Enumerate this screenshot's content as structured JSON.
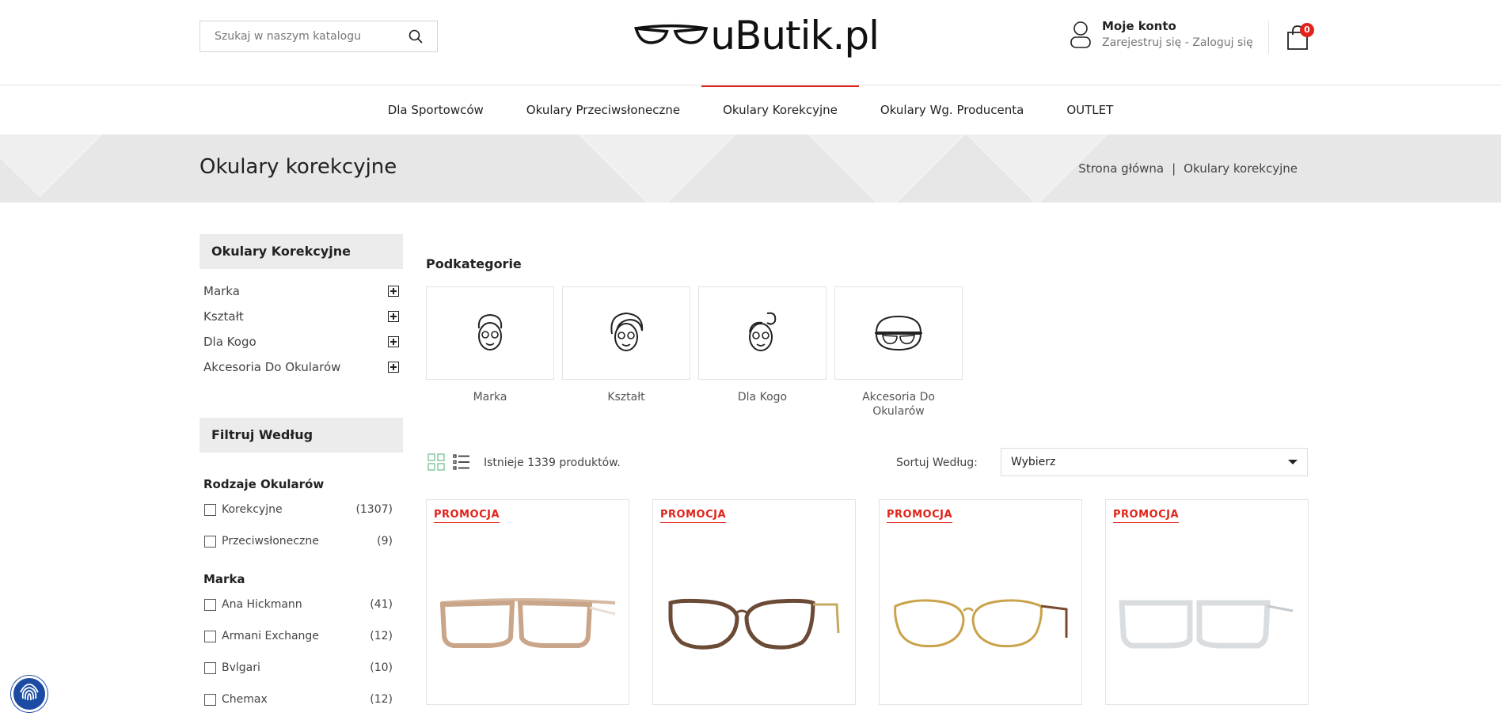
{
  "header": {
    "search_placeholder": "Szukaj w naszym katalogu",
    "logo_text": "uButik.pl",
    "account_title": "Moje konto",
    "account_links": "Zarejestruj się - Zaloguj się",
    "cart_count": "0"
  },
  "nav": {
    "items": [
      {
        "label": "Dla Sportowców"
      },
      {
        "label": "Okulary Przeciwsłoneczne"
      },
      {
        "label": "Okulary Korekcyjne"
      },
      {
        "label": "Okulary Wg. Producenta"
      },
      {
        "label": "OUTLET"
      }
    ],
    "active_index": 2
  },
  "banner": {
    "title": "Okulary korekcyjne",
    "breadcrumb": [
      "Strona główna",
      "|",
      "Okulary korekcyjne"
    ]
  },
  "sidebar": {
    "categories_title": "Okulary Korekcyjne",
    "categories": [
      {
        "label": "Marka"
      },
      {
        "label": "Kształt"
      },
      {
        "label": "Dla Kogo"
      },
      {
        "label": "Akcesoria Do Okularów"
      }
    ],
    "filter_title": "Filtruj Według",
    "groups": [
      {
        "title": "Rodzaje Okularów",
        "items": [
          {
            "label": "Korekcyjne",
            "count": "(1307)"
          },
          {
            "label": "Przeciwsłoneczne",
            "count": "(9)"
          }
        ]
      },
      {
        "title": "Marka",
        "items": [
          {
            "label": "Ana Hickmann",
            "count": "(41)"
          },
          {
            "label": "Armani Exchange",
            "count": "(12)"
          },
          {
            "label": "Bvlgari",
            "count": "(10)"
          },
          {
            "label": "Chemax",
            "count": "(12)"
          }
        ]
      }
    ]
  },
  "main": {
    "subcategories_title": "Podkategorie",
    "subcategories": [
      {
        "label": "Marka",
        "icon": "woman-face-icon"
      },
      {
        "label": "Kształt",
        "icon": "woman-hair-icon"
      },
      {
        "label": "Dla Kogo",
        "icon": "girl-face-icon"
      },
      {
        "label": "Akcesoria Do Okularów",
        "icon": "glasses-case-icon"
      }
    ],
    "product_count": "Istnieje 1339 produktów.",
    "sort_label": "Sortuj Według:",
    "sort_value": "Wybierz",
    "products": [
      {
        "badge": "PROMOCJA",
        "frame_color": "#c9a58a"
      },
      {
        "badge": "PROMOCJA",
        "frame_color": "#6b4a36"
      },
      {
        "badge": "PROMOCJA",
        "frame_color": "#c9a24a"
      },
      {
        "badge": "PROMOCJA",
        "frame_color": "#d9dde0"
      }
    ]
  },
  "colors": {
    "accent": "#e2231a",
    "banner": "#e7e7e7",
    "fingerprint_button": "#1b4ba3"
  }
}
